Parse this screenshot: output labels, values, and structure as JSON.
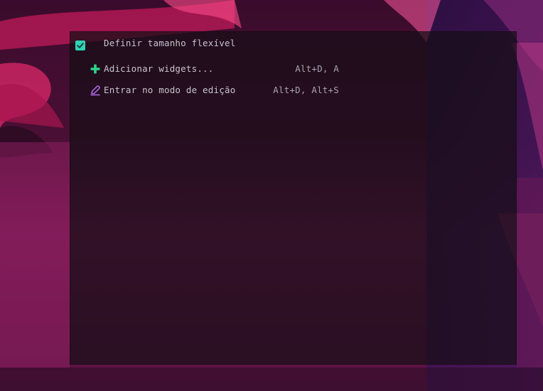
{
  "menu": {
    "flexible_size": {
      "label": "Definir tamanho flexível",
      "checked": true,
      "icon": "checkbox-checked-icon"
    },
    "add_widgets": {
      "label": "Adicionar widgets...",
      "shortcut": "Alt+D, A",
      "icon": "plus-icon"
    },
    "edit_mode": {
      "label": "Entrar no modo de edição",
      "shortcut": "Alt+D, Alt+S",
      "icon": "pencil-icon"
    }
  },
  "colors": {
    "checkbox": "#2fd3b5",
    "plus_icon": "#2fd38a",
    "pencil_icon": "#b46cf0"
  }
}
